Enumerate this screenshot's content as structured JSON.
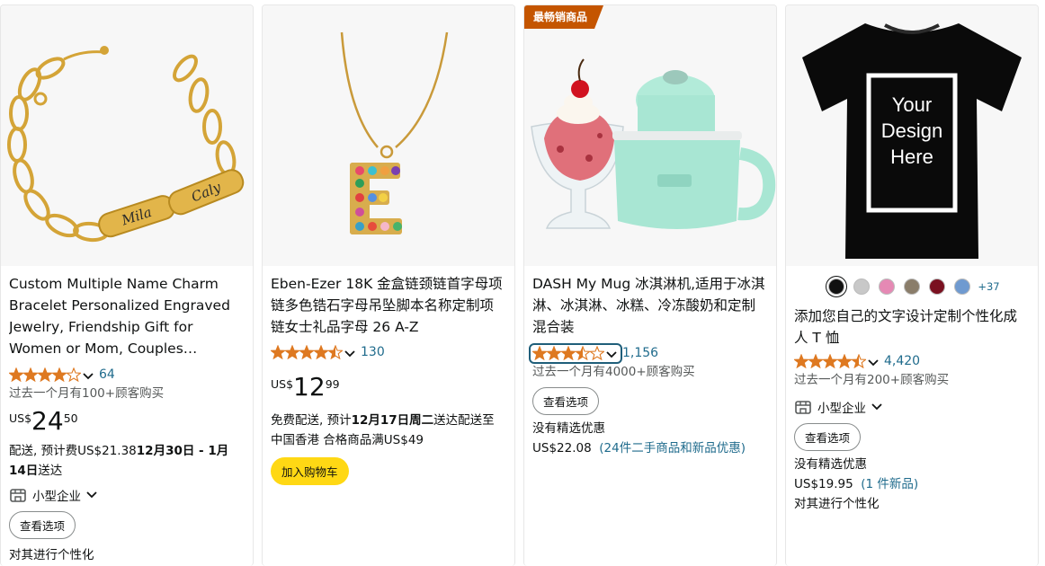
{
  "products": [
    {
      "title": "Custom Multiple Name Charm Bracelet Personalized Engraved Jewelry, Friendship Gift for Women or Mom, Couples Bracelet, Holiday Gift",
      "rating": 4.0,
      "rating_count": "64",
      "bought": "过去一个月有100+顾客购买",
      "price_currency": "US$",
      "price_whole": "24",
      "price_fraction": "50",
      "delivery_prefix": "配送, 预计费US$21.38",
      "delivery_date": "12月30日 - 1月14日",
      "delivery_suffix": "送达",
      "small_business": "小型企业",
      "options_button": "查看选项",
      "personalize": "对其进行个性化",
      "engrave_1": "Mila",
      "engrave_2": "Caly"
    },
    {
      "title": "Eben-Ezer 18K 金盒链颈链首字母项链多色锆石字母吊坠脚本名称定制项链女士礼品字母 26 A-Z",
      "rating": 4.5,
      "rating_count": "130",
      "price_currency": "US$",
      "price_whole": "12",
      "price_fraction": "99",
      "delivery_prefix": "免费配送, 预计",
      "delivery_date": "12月17日周二",
      "delivery_suffix": "送达配送至中国香港 合格商品满US$49",
      "cart_button": "加入购物车"
    },
    {
      "badge": "最畅销商品",
      "title": "DASH My Mug 冰淇淋机,适用于冰淇淋、冰淇淋、冰糕、冷冻酸奶和定制混合装",
      "rating": 3.5,
      "rating_count": "1,156",
      "bought": "过去一个月有4000+顾客购买",
      "options_button": "查看选项",
      "no_featured": "没有精选优惠",
      "used_price": "US$22.08",
      "used_offers": "(24件二手商品和新品优惠)"
    },
    {
      "tshirt_text_1": "Your",
      "tshirt_text_2": "Design",
      "tshirt_text_3": "Here",
      "swatch_colors": [
        "#111111",
        "#c8c8c8",
        "#e589b4",
        "#8a7d6a",
        "#7a1020",
        "#6f9ad0"
      ],
      "more_colors": "+37",
      "title": "添加您自己的文字设计定制个性化成人 T 恤",
      "rating": 4.5,
      "rating_count": "4,420",
      "bought": "过去一个月有200+顾客购买",
      "small_business": "小型企业",
      "options_button": "查看选项",
      "no_featured": "没有精选优惠",
      "used_price": "US$19.95",
      "used_offers": "(1 件新品)",
      "personalize": "对其进行个性化"
    }
  ],
  "colors": {
    "star": "#de7921",
    "link": "#1f6b8c",
    "badge": "#c45500",
    "cart": "#ffd814",
    "gold": "#d4a437",
    "mug": "#a8e6d3"
  }
}
